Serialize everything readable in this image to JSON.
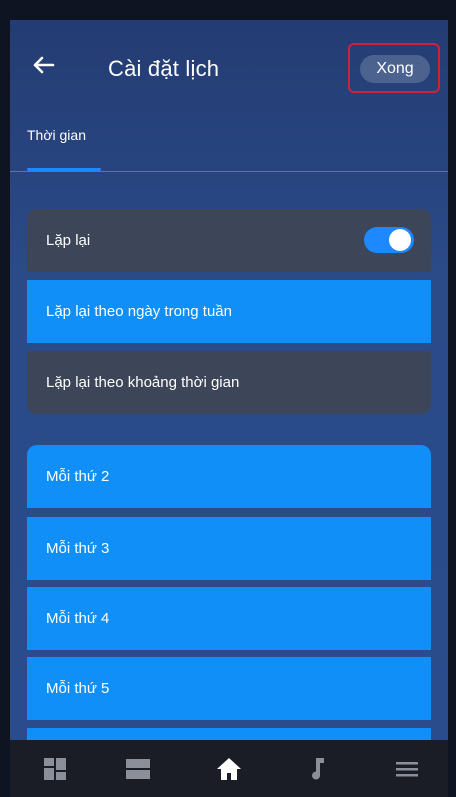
{
  "header": {
    "title": "Cài đặt lịch",
    "done_label": "Xong"
  },
  "tabs": [
    {
      "label": "Thời gian",
      "active": true
    }
  ],
  "repeat": {
    "label": "Lặp lại",
    "enabled": true
  },
  "repeat_options": [
    {
      "label": "Lặp lại theo ngày trong tuần",
      "selected": true
    },
    {
      "label": "Lặp lại theo khoảng thời gian",
      "selected": false
    }
  ],
  "days": [
    {
      "label": "Mỗi thứ 2"
    },
    {
      "label": "Mỗi thứ 3"
    },
    {
      "label": "Mỗi thứ 4"
    },
    {
      "label": "Mỗi thứ 5"
    }
  ],
  "bottom_nav": [
    {
      "icon": "dashboard-icon"
    },
    {
      "icon": "list-icon"
    },
    {
      "icon": "home-icon",
      "active": true
    },
    {
      "icon": "music-note-icon"
    },
    {
      "icon": "menu-icon"
    }
  ],
  "colors": {
    "accent": "#0f8ff7",
    "card_dark": "#3c4658",
    "highlight_border": "#d21f3c",
    "background_top": "#243c73"
  }
}
